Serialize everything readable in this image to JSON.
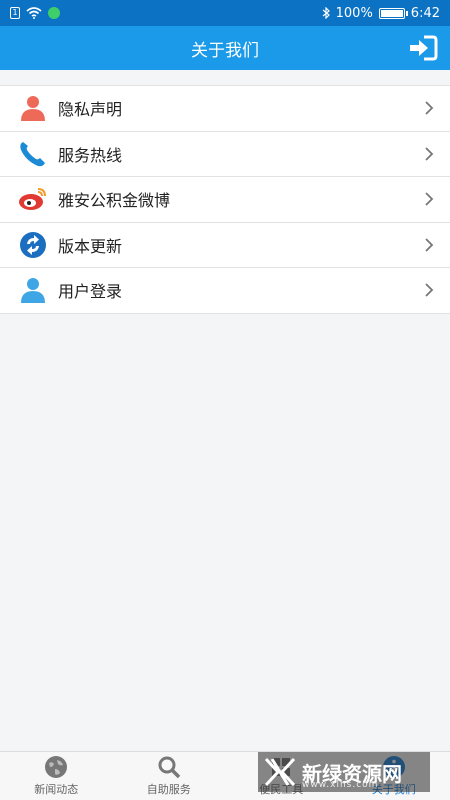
{
  "status": {
    "battery": "100%",
    "time": "6:42",
    "battery_level": 1.0
  },
  "header": {
    "title": "关于我们"
  },
  "menu": [
    {
      "label": "隐私声明",
      "icon": "person-icon"
    },
    {
      "label": "服务热线",
      "icon": "phone-icon"
    },
    {
      "label": "雅安公积金微博",
      "icon": "weibo-icon"
    },
    {
      "label": "版本更新",
      "icon": "refresh-icon"
    },
    {
      "label": "用户登录",
      "icon": "user-icon"
    }
  ],
  "tabs": [
    {
      "label": "新闻动态",
      "icon": "globe-icon",
      "active": false
    },
    {
      "label": "自助服务",
      "icon": "search-icon",
      "active": false
    },
    {
      "label": "便民工具",
      "icon": "tools-icon",
      "active": false
    },
    {
      "label": "关于我们",
      "icon": "info-icon",
      "active": true
    }
  ],
  "watermark": {
    "text": "新绿资源网",
    "sub": "www.xlhs.com"
  },
  "colors": {
    "status_bar": "#0b72c4",
    "nav_bar": "#1a9ae8",
    "active_tab": "#1a7fd8"
  }
}
